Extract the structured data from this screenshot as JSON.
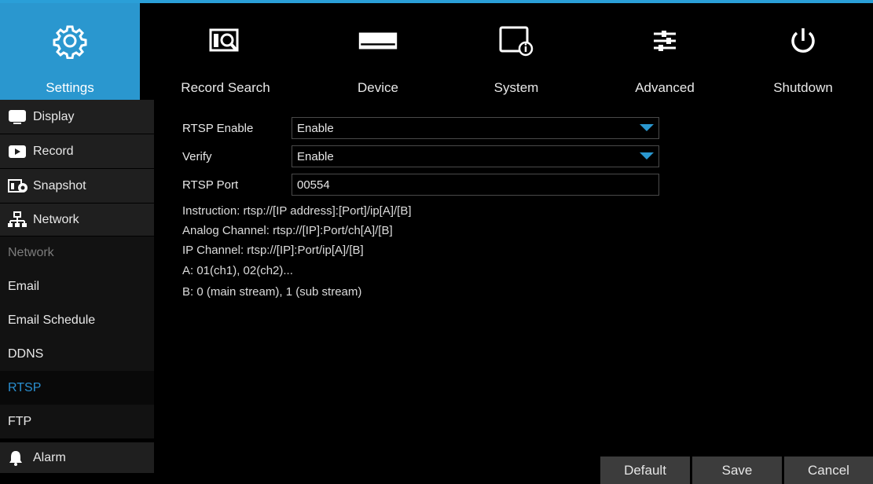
{
  "nav": {
    "tabs": [
      {
        "label": "Settings",
        "icon": "gear-icon",
        "active": true
      },
      {
        "label": "Record Search",
        "icon": "record-search-icon",
        "active": false
      },
      {
        "label": "Device",
        "icon": "hard-drive-icon",
        "active": false
      },
      {
        "label": "System",
        "icon": "system-info-icon",
        "active": false
      },
      {
        "label": "Advanced",
        "icon": "sliders-icon",
        "active": false
      },
      {
        "label": "Shutdown",
        "icon": "power-icon",
        "active": false
      }
    ],
    "accent_color": "#2a97cf"
  },
  "sidebar": {
    "display": {
      "label": "Display",
      "icon": "monitor-icon"
    },
    "record": {
      "label": "Record",
      "icon": "video-icon"
    },
    "snapshot": {
      "label": "Snapshot",
      "icon": "snapshot-icon"
    },
    "network": {
      "label": "Network",
      "icon": "network-icon"
    },
    "network_sub": {
      "header": "Network",
      "email": "Email",
      "email_schedule": "Email Schedule",
      "ddns": "DDNS",
      "rtsp": "RTSP",
      "ftp": "FTP"
    },
    "alarm": {
      "label": "Alarm",
      "icon": "bell-icon"
    }
  },
  "form": {
    "rtsp_enable": {
      "label": "RTSP Enable",
      "value": "Enable"
    },
    "verify": {
      "label": "Verify",
      "value": "Enable"
    },
    "rtsp_port": {
      "label": "RTSP Port",
      "value": "00554"
    }
  },
  "info": {
    "instruction": "Instruction: rtsp://[IP address]:[Port]/ip[A]/[B]",
    "analog": "Analog Channel:  rtsp://[IP]:Port/ch[A]/[B]",
    "ip": "IP Channel:  rtsp://[IP]:Port/ip[A]/[B]",
    "a": "A: 01(ch1), 02(ch2)...",
    "b": "B: 0 (main stream), 1 (sub stream)"
  },
  "buttons": {
    "default": "Default",
    "save": "Save",
    "cancel": "Cancel"
  }
}
